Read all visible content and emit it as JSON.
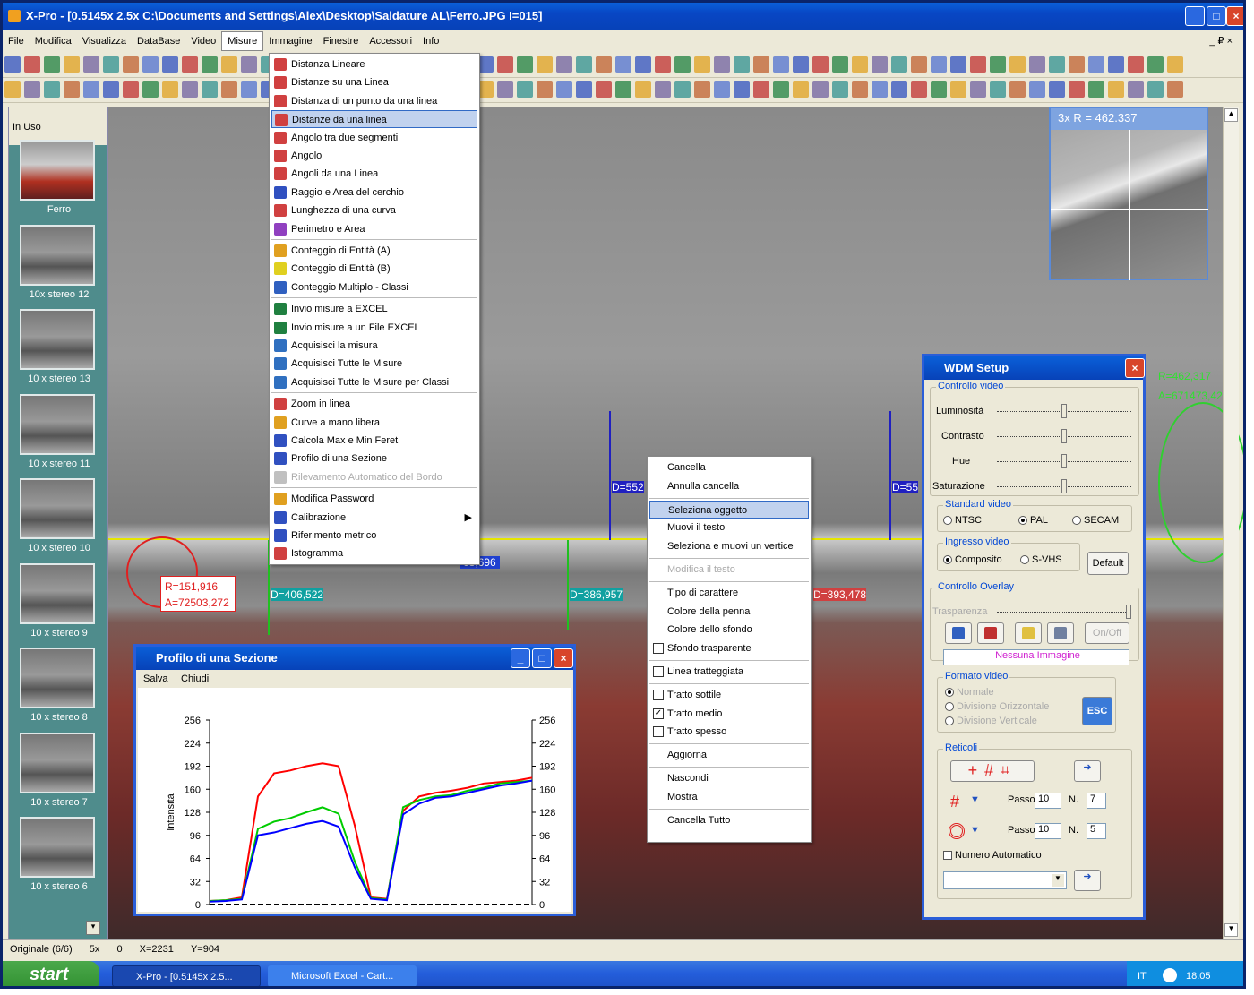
{
  "window": {
    "title": "X-Pro - [0.5145x 2.5x  C:\\Documents and Settings\\Alex\\Desktop\\Saldature AL\\Ferro.JPG I=015]",
    "min": "_",
    "max": "□",
    "close": "×"
  },
  "menubar": {
    "items": [
      "File",
      "Modifica",
      "Visualizza",
      "DataBase",
      "Video",
      "Misure",
      "Immagine",
      "Finestre",
      "Accessori",
      "Info"
    ],
    "right": "_ ₽ ×"
  },
  "sidebar": {
    "header": "In Uso",
    "items": [
      "Ferro",
      "10x stereo 12",
      "10 x stereo 13",
      "10 x stereo 11",
      "10 x stereo 10",
      "10 x stereo 9",
      "10 x stereo 8",
      "10 x stereo 7",
      "10 x stereo 6"
    ]
  },
  "misure_menu": {
    "items": [
      {
        "label": "Distanza Lineare",
        "sel": false,
        "dis": false,
        "color": "#d04040"
      },
      {
        "label": "Distanze su una Linea",
        "sel": false,
        "dis": false,
        "color": "#d04040"
      },
      {
        "label": "Distanza di un punto da una linea",
        "sel": false,
        "dis": false,
        "color": "#d04040"
      },
      {
        "label": "Distanze da una linea",
        "sel": true,
        "dis": false,
        "color": "#d04040"
      },
      {
        "label": "Angolo tra due segmenti",
        "sel": false,
        "dis": false,
        "color": "#d04040"
      },
      {
        "label": "Angolo",
        "sel": false,
        "dis": false,
        "color": "#d04040"
      },
      {
        "label": "Angoli da una Linea",
        "sel": false,
        "dis": false,
        "color": "#d04040"
      },
      {
        "label": "Raggio e Area del cerchio",
        "sel": false,
        "dis": false,
        "color": "#3050c0"
      },
      {
        "label": "Lunghezza di una curva",
        "sel": false,
        "dis": false,
        "color": "#d04040"
      },
      {
        "label": "Perimetro e Area",
        "sel": false,
        "dis": false,
        "color": "#9040c0"
      },
      {
        "label": "Conteggio di Entità (A)",
        "sel": false,
        "dis": false,
        "color": "#e0a020"
      },
      {
        "label": "Conteggio di Entità (B)",
        "sel": false,
        "dis": false,
        "color": "#e0d020"
      },
      {
        "label": "Conteggio Multiplo - Classi",
        "sel": false,
        "dis": false,
        "color": "#3060c0"
      },
      {
        "label": "Invio misure a EXCEL",
        "sel": false,
        "dis": false,
        "color": "#208040"
      },
      {
        "label": "Invio misure a un File EXCEL",
        "sel": false,
        "dis": false,
        "color": "#208040"
      },
      {
        "label": "Acquisisci la misura",
        "sel": false,
        "dis": false,
        "color": "#3070c0"
      },
      {
        "label": "Acquisisci Tutte le Misure",
        "sel": false,
        "dis": false,
        "color": "#3070c0"
      },
      {
        "label": "Acquisisci Tutte le Misure per Classi",
        "sel": false,
        "dis": false,
        "color": "#3070c0"
      },
      {
        "label": "Zoom in linea",
        "sel": false,
        "dis": false,
        "color": "#d04040"
      },
      {
        "label": "Curve a mano libera",
        "sel": false,
        "dis": false,
        "color": "#e0a020"
      },
      {
        "label": "Calcola Max e Min Feret",
        "sel": false,
        "dis": false,
        "color": "#3050c0"
      },
      {
        "label": "Profilo di una Sezione",
        "sel": false,
        "dis": false,
        "color": "#3050c0"
      },
      {
        "label": "Rilevamento Automatico del Bordo",
        "sel": false,
        "dis": true,
        "color": "#c0c0c0"
      },
      {
        "label": "Modifica Password",
        "sel": false,
        "dis": false,
        "color": "#e0a020"
      },
      {
        "label": "Calibrazione",
        "sel": false,
        "dis": false,
        "color": "#3050c0",
        "arrow": "▶"
      },
      {
        "label": "Riferimento metrico",
        "sel": false,
        "dis": false,
        "color": "#3050c0"
      },
      {
        "label": "Istogramma",
        "sel": false,
        "dis": false,
        "color": "#d04040"
      }
    ]
  },
  "context_menu": {
    "items": [
      {
        "label": "Cancella"
      },
      {
        "label": "Annulla cancella"
      },
      {
        "label": "Seleziona oggetto",
        "sel": true
      },
      {
        "label": "Muovi il testo"
      },
      {
        "label": "Seleziona e muovi un vertice"
      },
      {
        "label": "Modifica il testo",
        "dis": true
      },
      {
        "label": "Tipo di carattere"
      },
      {
        "label": "Colore della penna"
      },
      {
        "label": "Colore dello sfondo"
      },
      {
        "label": "Sfondo trasparente",
        "check": "off"
      },
      {
        "label": "Linea tratteggiata",
        "check": "off"
      },
      {
        "label": "Tratto sottile",
        "check": "off"
      },
      {
        "label": "Tratto medio",
        "check": "on"
      },
      {
        "label": "Tratto spesso",
        "check": "off"
      },
      {
        "label": "Aggiorna"
      },
      {
        "label": "Nascondi"
      },
      {
        "label": "Mostra"
      },
      {
        "label": "Cancella Tutto"
      }
    ]
  },
  "measurements": {
    "d1": "D=552",
    "d2": "D=55",
    "d3": "D=406,522",
    "d4": "D=386,957",
    "d5": "D=393,478",
    "d6": "08,696",
    "circle_r": "R=151,916",
    "circle_a": "A=72503,272",
    "right_r": "R=462,317",
    "right_a": "A=671473,42"
  },
  "zoom_inset": {
    "label": "3x  R = 462.337"
  },
  "profile": {
    "title": "Profilo di una Sezione",
    "menu": [
      "Salva",
      "Chiudi"
    ]
  },
  "chart_data": {
    "type": "line",
    "title": "",
    "xlabel": "",
    "ylabel": "Intensità",
    "ylim": [
      0,
      256
    ],
    "yticks": [
      0,
      32,
      64,
      96,
      128,
      160,
      192,
      224,
      256
    ],
    "x": [
      0,
      5,
      10,
      15,
      20,
      25,
      30,
      35,
      40,
      45,
      50,
      55,
      60,
      65,
      70,
      75,
      80,
      85,
      90,
      95,
      100
    ],
    "series": [
      {
        "name": "",
        "color": "#ff0000",
        "values": [
          5,
          6,
          10,
          150,
          182,
          186,
          192,
          196,
          192,
          110,
          10,
          8,
          130,
          150,
          155,
          158,
          162,
          168,
          170,
          172,
          176
        ]
      },
      {
        "name": "",
        "color": "#00cc00",
        "values": [
          5,
          6,
          8,
          105,
          115,
          120,
          128,
          135,
          126,
          60,
          9,
          7,
          135,
          145,
          150,
          152,
          158,
          162,
          168,
          170,
          172
        ]
      },
      {
        "name": "",
        "color": "#0000ff",
        "values": [
          4,
          5,
          7,
          96,
          100,
          106,
          112,
          116,
          108,
          52,
          8,
          6,
          125,
          140,
          148,
          150,
          155,
          160,
          165,
          168,
          172
        ]
      }
    ]
  },
  "wdm": {
    "title": "WDM Setup",
    "controllo_video": "Controllo video",
    "luminosita": "Luminosità",
    "contrasto": "Contrasto",
    "hue": "Hue",
    "saturazione": "Saturazione",
    "standard_video": "Standard video",
    "ntsc": "NTSC",
    "pal": "PAL",
    "secam": "SECAM",
    "ingresso_video": "Ingresso video",
    "composito": "Composito",
    "svhs": "S-VHS",
    "default": "Default",
    "controllo_overlay": "Controllo Overlay",
    "trasparenza": "Trasparenza",
    "onoff": "On/Off",
    "nessuna": "Nessuna Immagine",
    "formato_video": "Formato video",
    "normale": "Normale",
    "div_orizz": "Divisione Orizzontale",
    "div_vert": "Divisione Verticale",
    "esc": "ESC",
    "reticoli": "Reticoli",
    "passo": "Passo",
    "n": "N.",
    "passo1": "10",
    "n1": "7",
    "passo2": "10",
    "n2": "5",
    "numero_automatico": "Numero Automatico"
  },
  "status": {
    "originale": "Originale (6/6)",
    "zoom": "5x",
    "rot": "0",
    "x": "X=2231",
    "y": "Y=904"
  },
  "taskbar": {
    "start": "start",
    "task1": "X-Pro - [0.5145x 2.5...",
    "task2": "Microsoft Excel - Cart...",
    "lang": "IT",
    "time": "18.05"
  }
}
